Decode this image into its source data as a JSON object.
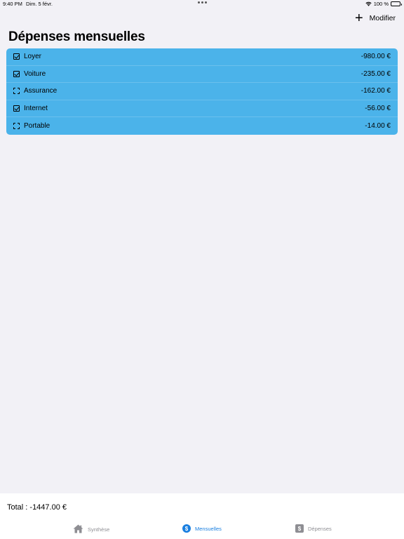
{
  "status_bar": {
    "time": "9:40 PM",
    "date": "Dim. 5 févr.",
    "battery": "100 %",
    "icons": [
      "wifi-icon",
      "battery-icon"
    ]
  },
  "nav": {
    "add_label": "+",
    "edit_label": "Modifier",
    "title": "Dépenses mensuelles"
  },
  "list": {
    "background_color": "#4bb3ea",
    "items": [
      {
        "label": "Loyer",
        "amount": "-980.00 €",
        "checked": true
      },
      {
        "label": "Voiture",
        "amount": "-235.00 €",
        "checked": true
      },
      {
        "label": "Assurance",
        "amount": "-162.00 €",
        "checked": false
      },
      {
        "label": "Internet",
        "amount": "-56.00 €",
        "checked": true
      },
      {
        "label": "Portable",
        "amount": "-14.00 €",
        "checked": false
      }
    ]
  },
  "footer": {
    "total": "Total : -1447.00 €"
  },
  "tabs": [
    {
      "label": "Synthèse",
      "icon": "house-icon",
      "active": false
    },
    {
      "label": "Mensuelles",
      "icon": "dollar-circle-icon",
      "active": true
    },
    {
      "label": "Dépenses",
      "icon": "dollar-square-icon",
      "active": false
    }
  ],
  "colors": {
    "accent": "#1a7fe0",
    "inactive_tab": "#8e8e93",
    "background": "#f2f1f6"
  }
}
